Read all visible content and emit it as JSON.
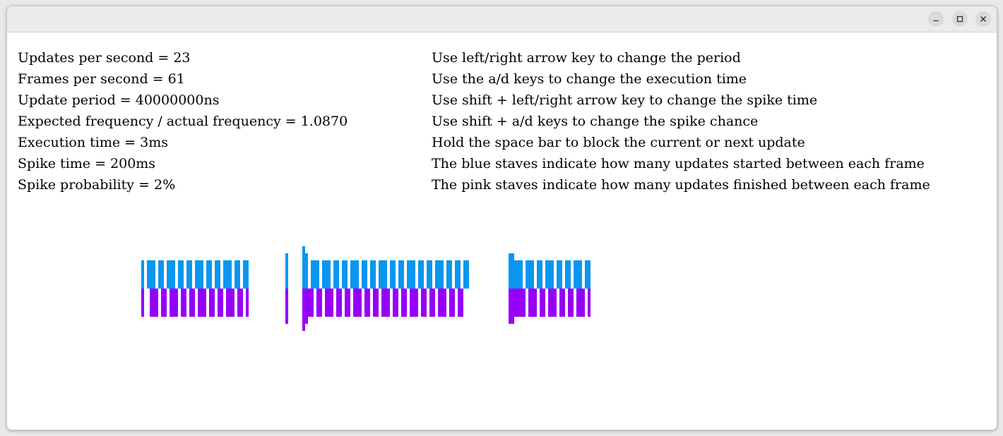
{
  "stats": [
    {
      "label": "Updates per second",
      "value": "23"
    },
    {
      "label": "Frames per second",
      "value": "61"
    },
    {
      "label": "Update period",
      "value": "40000000ns"
    },
    {
      "label": "Expected frequency / actual frequency",
      "value": "1.0870"
    },
    {
      "label": "Execution time",
      "value": "3ms"
    },
    {
      "label": "Spike time",
      "value": "200ms"
    },
    {
      "label": "Spike probability",
      "value": "2%"
    }
  ],
  "stat_lines": [
    "Updates per second = 23",
    "Frames per second = 61",
    "Update period = 40000000ns",
    "Expected frequency / actual frequency = 1.0870",
    "Execution time = 3ms",
    "Spike time = 200ms",
    "Spike probability = 2%"
  ],
  "instructions": [
    "Use left/right arrow key to change the period",
    "Use the a/d keys to change the execution time",
    "Use shift + left/right arrow key to change the spike time",
    "Use shift + a/d keys to change the spike chance",
    "Hold the space bar to block the current or next update",
    "The blue staves indicate how many updates started between each frame",
    "The pink staves indicate how many updates finished between each frame"
  ],
  "colors": {
    "started": "#0a96f0",
    "finished": "#9600f8"
  },
  "icons": {
    "minimize": "minimize-icon",
    "maximize": "maximize-icon",
    "close": "close-icon"
  },
  "staves": {
    "frames": [
      {
        "started": 1,
        "finished": 1
      },
      {
        "started": 0,
        "finished": 0
      },
      {
        "started": 1,
        "finished": 0
      },
      {
        "started": 1,
        "finished": 1
      },
      {
        "started": 1,
        "finished": 1
      },
      {
        "started": 0,
        "finished": 1
      },
      {
        "started": 1,
        "finished": 0
      },
      {
        "started": 1,
        "finished": 1
      },
      {
        "started": 0,
        "finished": 1
      },
      {
        "started": 1,
        "finished": 0
      },
      {
        "started": 1,
        "finished": 1
      },
      {
        "started": 1,
        "finished": 1
      },
      {
        "started": 0,
        "finished": 1
      },
      {
        "started": 1,
        "finished": 0
      },
      {
        "started": 1,
        "finished": 1
      },
      {
        "started": 0,
        "finished": 1
      },
      {
        "started": 1,
        "finished": 0
      },
      {
        "started": 1,
        "finished": 1
      },
      {
        "started": 0,
        "finished": 1
      },
      {
        "started": 1,
        "finished": 0
      },
      {
        "started": 1,
        "finished": 1
      },
      {
        "started": 1,
        "finished": 1
      },
      {
        "started": 0,
        "finished": 1
      },
      {
        "started": 1,
        "finished": 0
      },
      {
        "started": 1,
        "finished": 1
      },
      {
        "started": 0,
        "finished": 1
      },
      {
        "started": 1,
        "finished": 0
      },
      {
        "started": 1,
        "finished": 1
      },
      {
        "started": 0,
        "finished": 1
      },
      {
        "started": 1,
        "finished": 0
      },
      {
        "started": 1,
        "finished": 1
      },
      {
        "started": 1,
        "finished": 1
      },
      {
        "started": 0,
        "finished": 1
      },
      {
        "started": 1,
        "finished": 0
      },
      {
        "started": 1,
        "finished": 1
      },
      {
        "started": 0,
        "finished": 1
      },
      {
        "started": 1,
        "finished": 0
      },
      {
        "started": 1,
        "finished": 1
      },
      {
        "started": 0,
        "finished": 0
      },
      {
        "started": 0,
        "finished": 0
      },
      {
        "started": 0,
        "finished": 0
      },
      {
        "started": 0,
        "finished": 0
      },
      {
        "started": 0,
        "finished": 0
      },
      {
        "started": 0,
        "finished": 0
      },
      {
        "started": 0,
        "finished": 0
      },
      {
        "started": 0,
        "finished": 0
      },
      {
        "started": 0,
        "finished": 0
      },
      {
        "started": 0,
        "finished": 0
      },
      {
        "started": 0,
        "finished": 0
      },
      {
        "started": 0,
        "finished": 0
      },
      {
        "started": 0,
        "finished": 0
      },
      {
        "started": 2,
        "finished": 2
      },
      {
        "started": 0,
        "finished": 0
      },
      {
        "started": 0,
        "finished": 0
      },
      {
        "started": 0,
        "finished": 0
      },
      {
        "started": 0,
        "finished": 0
      },
      {
        "started": 0,
        "finished": 0
      },
      {
        "started": 3,
        "finished": 3
      },
      {
        "started": 2,
        "finished": 2
      },
      {
        "started": 0,
        "finished": 1
      },
      {
        "started": 1,
        "finished": 1
      },
      {
        "started": 1,
        "finished": 0
      },
      {
        "started": 1,
        "finished": 1
      },
      {
        "started": 0,
        "finished": 1
      },
      {
        "started": 1,
        "finished": 0
      },
      {
        "started": 1,
        "finished": 1
      },
      {
        "started": 1,
        "finished": 1
      },
      {
        "started": 0,
        "finished": 1
      },
      {
        "started": 1,
        "finished": 0
      },
      {
        "started": 1,
        "finished": 1
      },
      {
        "started": 0,
        "finished": 1
      },
      {
        "started": 1,
        "finished": 0
      },
      {
        "started": 1,
        "finished": 1
      },
      {
        "started": 0,
        "finished": 1
      },
      {
        "started": 1,
        "finished": 0
      },
      {
        "started": 1,
        "finished": 1
      },
      {
        "started": 1,
        "finished": 1
      },
      {
        "started": 0,
        "finished": 1
      },
      {
        "started": 1,
        "finished": 0
      },
      {
        "started": 1,
        "finished": 1
      },
      {
        "started": 0,
        "finished": 1
      },
      {
        "started": 1,
        "finished": 0
      },
      {
        "started": 1,
        "finished": 1
      },
      {
        "started": 0,
        "finished": 1
      },
      {
        "started": 1,
        "finished": 0
      },
      {
        "started": 1,
        "finished": 1
      },
      {
        "started": 1,
        "finished": 1
      },
      {
        "started": 0,
        "finished": 1
      },
      {
        "started": 1,
        "finished": 0
      },
      {
        "started": 1,
        "finished": 1
      },
      {
        "started": 0,
        "finished": 1
      },
      {
        "started": 1,
        "finished": 0
      },
      {
        "started": 1,
        "finished": 1
      },
      {
        "started": 0,
        "finished": 1
      },
      {
        "started": 1,
        "finished": 0
      },
      {
        "started": 1,
        "finished": 1
      },
      {
        "started": 1,
        "finished": 1
      },
      {
        "started": 0,
        "finished": 1
      },
      {
        "started": 1,
        "finished": 0
      },
      {
        "started": 1,
        "finished": 1
      },
      {
        "started": 0,
        "finished": 1
      },
      {
        "started": 1,
        "finished": 0
      },
      {
        "started": 1,
        "finished": 1
      },
      {
        "started": 0,
        "finished": 1
      },
      {
        "started": 1,
        "finished": 0
      },
      {
        "started": 1,
        "finished": 1
      },
      {
        "started": 1,
        "finished": 1
      },
      {
        "started": 0,
        "finished": 1
      },
      {
        "started": 1,
        "finished": 0
      },
      {
        "started": 1,
        "finished": 1
      },
      {
        "started": 0,
        "finished": 1
      },
      {
        "started": 1,
        "finished": 0
      },
      {
        "started": 1,
        "finished": 1
      },
      {
        "started": 0,
        "finished": 1
      },
      {
        "started": 1,
        "finished": 0
      },
      {
        "started": 1,
        "finished": 0
      },
      {
        "started": 0,
        "finished": 0
      },
      {
        "started": 0,
        "finished": 0
      },
      {
        "started": 0,
        "finished": 0
      },
      {
        "started": 0,
        "finished": 0
      },
      {
        "started": 0,
        "finished": 0
      },
      {
        "started": 0,
        "finished": 0
      },
      {
        "started": 0,
        "finished": 0
      },
      {
        "started": 0,
        "finished": 0
      },
      {
        "started": 0,
        "finished": 0
      },
      {
        "started": 0,
        "finished": 0
      },
      {
        "started": 0,
        "finished": 0
      },
      {
        "started": 0,
        "finished": 0
      },
      {
        "started": 0,
        "finished": 0
      },
      {
        "started": 0,
        "finished": 0
      },
      {
        "started": 2,
        "finished": 2
      },
      {
        "started": 2,
        "finished": 2
      },
      {
        "started": 1,
        "finished": 1
      },
      {
        "started": 1,
        "finished": 1
      },
      {
        "started": 1,
        "finished": 1
      },
      {
        "started": 0,
        "finished": 1
      },
      {
        "started": 1,
        "finished": 0
      },
      {
        "started": 1,
        "finished": 1
      },
      {
        "started": 1,
        "finished": 1
      },
      {
        "started": 0,
        "finished": 1
      },
      {
        "started": 1,
        "finished": 0
      },
      {
        "started": 1,
        "finished": 1
      },
      {
        "started": 0,
        "finished": 1
      },
      {
        "started": 1,
        "finished": 0
      },
      {
        "started": 1,
        "finished": 1
      },
      {
        "started": 1,
        "finished": 1
      },
      {
        "started": 0,
        "finished": 1
      },
      {
        "started": 1,
        "finished": 0
      },
      {
        "started": 1,
        "finished": 1
      },
      {
        "started": 0,
        "finished": 1
      },
      {
        "started": 1,
        "finished": 0
      },
      {
        "started": 1,
        "finished": 1
      },
      {
        "started": 0,
        "finished": 1
      },
      {
        "started": 1,
        "finished": 0
      },
      {
        "started": 1,
        "finished": 1
      },
      {
        "started": 1,
        "finished": 1
      },
      {
        "started": 0,
        "finished": 1
      },
      {
        "started": 1,
        "finished": 0
      },
      {
        "started": 1,
        "finished": 1
      }
    ]
  }
}
